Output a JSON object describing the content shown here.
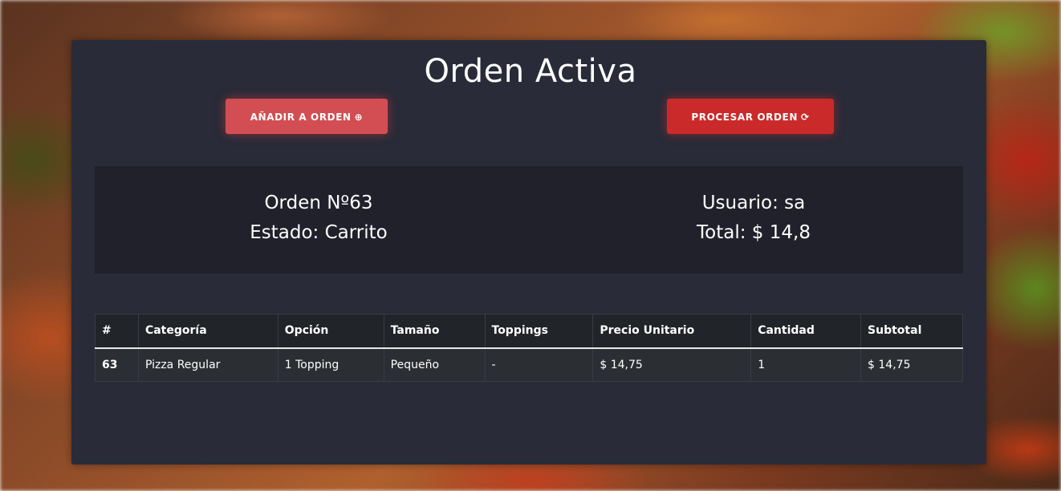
{
  "page": {
    "title": "Orden Activa"
  },
  "actions": {
    "add_label": "AÑADIR A ORDEN",
    "add_icon": "plus-circle-icon",
    "add_icon_glyph": "⊕",
    "process_label": "PROCESAR ORDEN",
    "process_icon": "refresh-icon",
    "process_icon_glyph": "⟳"
  },
  "order": {
    "number_text": "Orden Nº63",
    "status_text": "Estado: Carrito",
    "user_text": "Usuario: sa",
    "total_text": "Total: $ 14,8"
  },
  "table": {
    "headers": [
      "#",
      "Categoría",
      "Opción",
      "Tamaño",
      "Toppings",
      "Precio Unitario",
      "Cantidad",
      "Subtotal"
    ],
    "rows": [
      [
        "63",
        "Pizza Regular",
        "1 Topping",
        "Pequeño",
        "-",
        "$ 14,75",
        "1",
        "$ 14,75"
      ]
    ]
  },
  "colors": {
    "panel": "#292b38",
    "info_box": "#20212b",
    "add_button": "#d24e52",
    "process_button": "#cb2a2a"
  }
}
